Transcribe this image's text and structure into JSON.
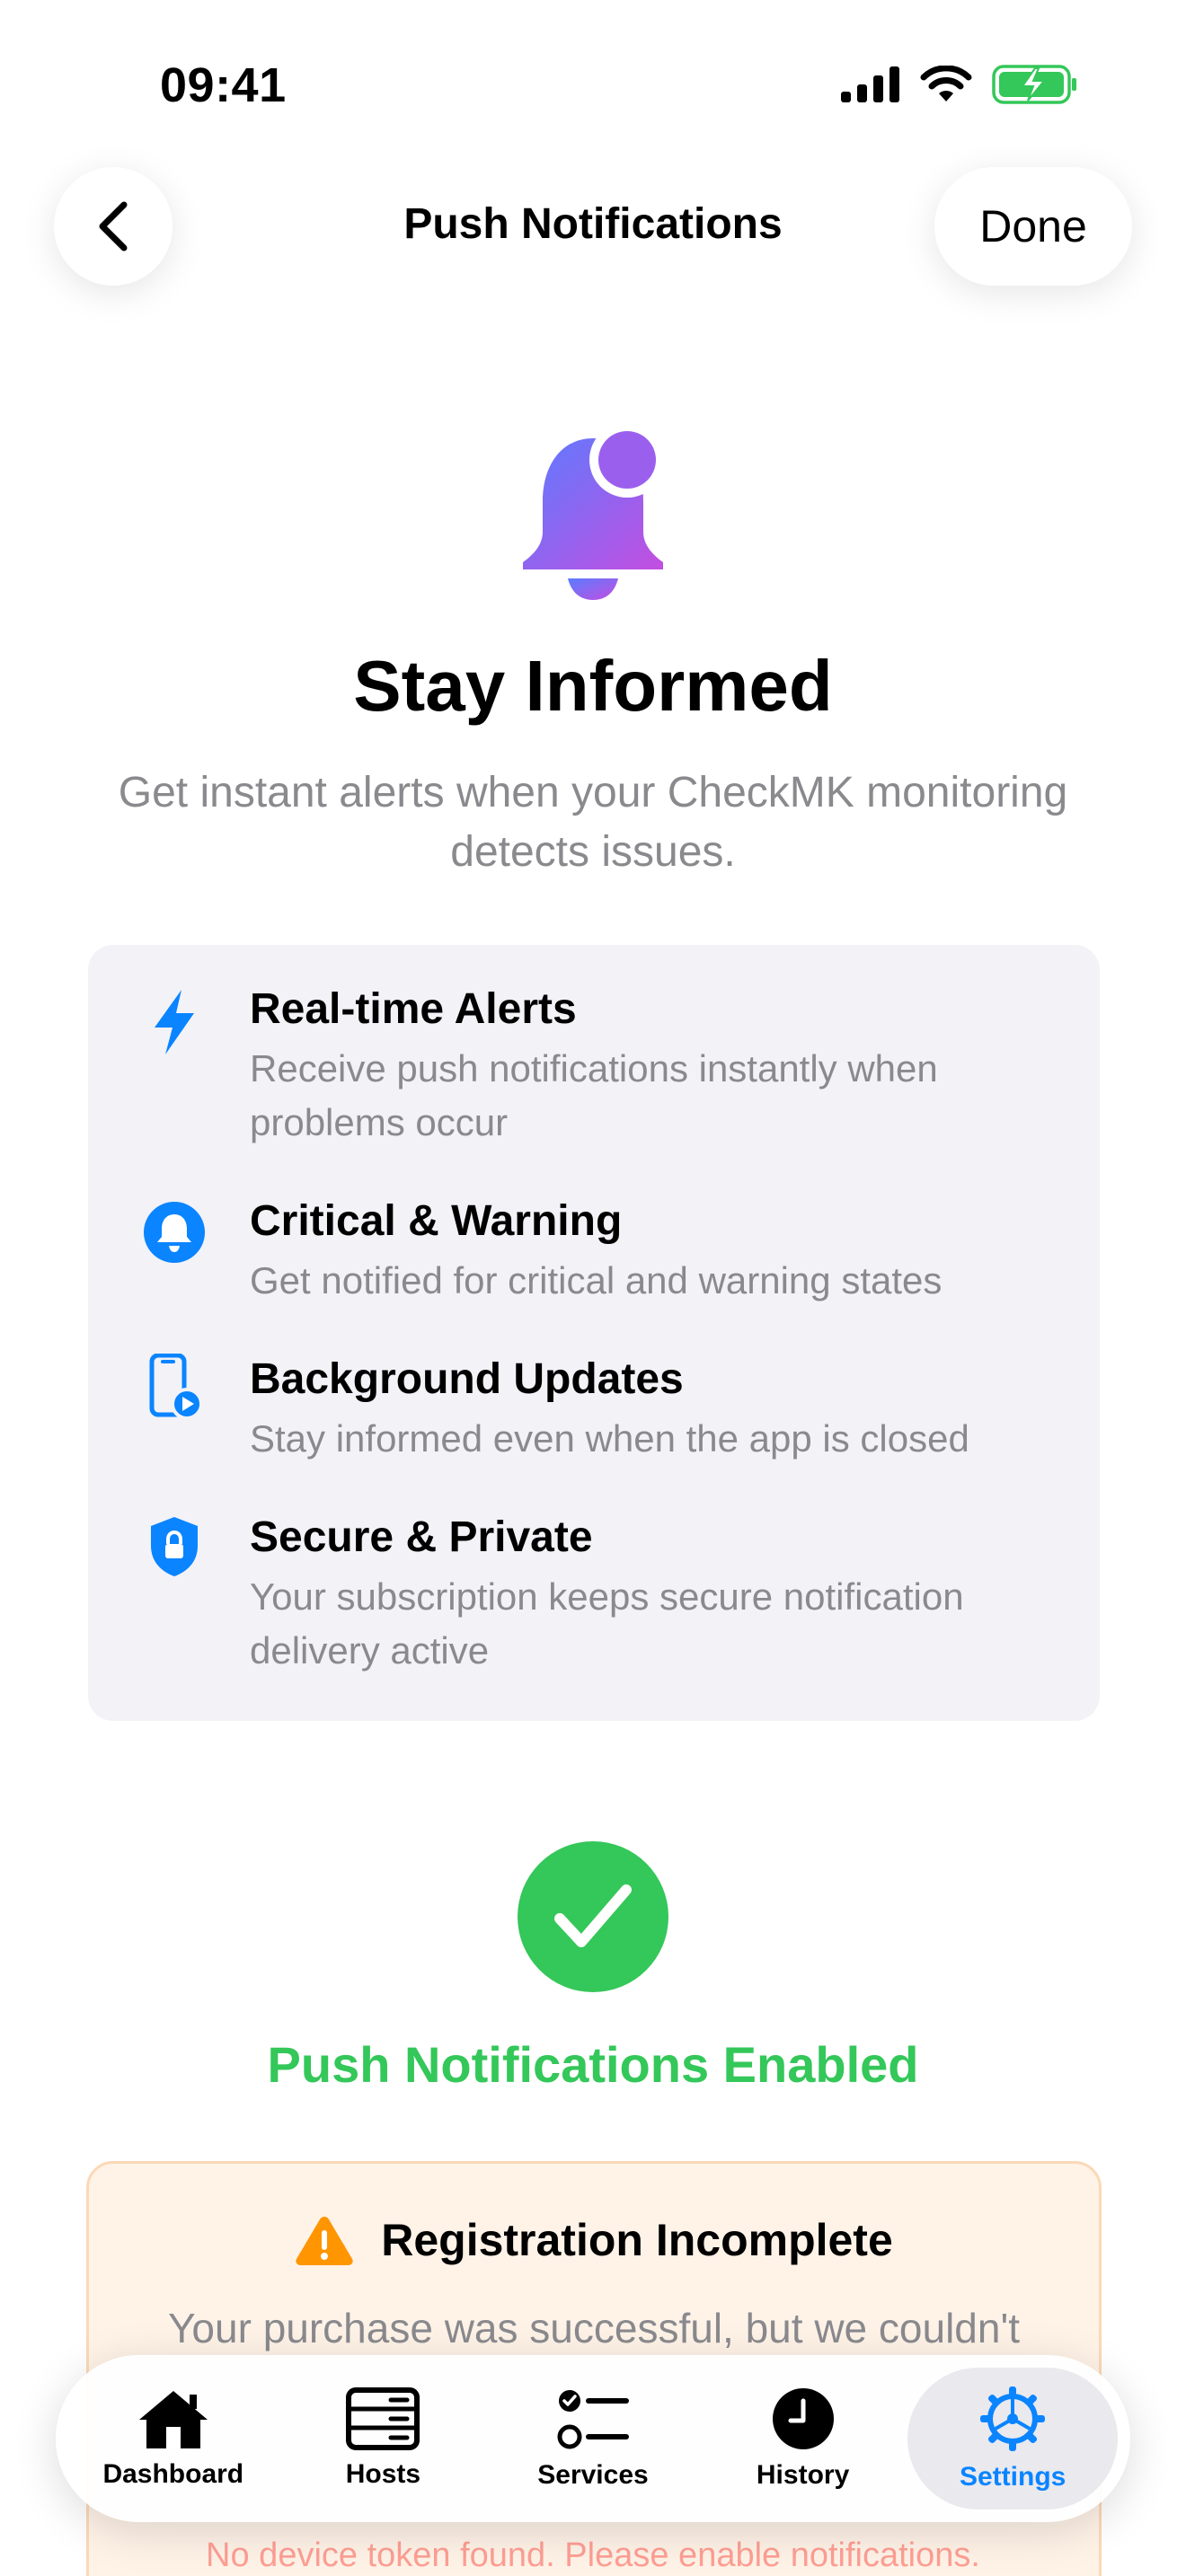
{
  "status_bar": {
    "time": "09:41"
  },
  "nav": {
    "title": "Push Notifications",
    "done_label": "Done"
  },
  "hero": {
    "title": "Stay Informed",
    "subtitle": "Get instant alerts when your CheckMK monitoring detects issues."
  },
  "features": [
    {
      "icon": "bolt-icon",
      "title": "Real-time Alerts",
      "description": "Receive push notifications instantly when problems occur"
    },
    {
      "icon": "bell-circle-icon",
      "title": "Critical & Warning",
      "description": "Get notified for critical and warning states"
    },
    {
      "icon": "phone-play-icon",
      "title": "Background Updates",
      "description": "Stay informed even when the app is closed"
    },
    {
      "icon": "shield-lock-icon",
      "title": "Secure & Private",
      "description": "Your subscription keeps secure notification delivery active"
    }
  ],
  "success": {
    "text": "Push Notifications Enabled"
  },
  "warning": {
    "title": "Registration Incomplete",
    "body": "Your purchase was successful, but we couldn't"
  },
  "bottom_error": "No device token found. Please enable notifications.",
  "tabs": [
    {
      "label": "Dashboard",
      "icon": "house-icon",
      "active": false
    },
    {
      "label": "Hosts",
      "icon": "server-icon",
      "active": false
    },
    {
      "label": "Services",
      "icon": "checklist-icon",
      "active": false
    },
    {
      "label": "History",
      "icon": "clock-icon",
      "active": false
    },
    {
      "label": "Settings",
      "icon": "gear-icon",
      "active": true
    }
  ],
  "colors": {
    "accent": "#0a84ff",
    "success": "#34c759",
    "warning": "#ff9500",
    "muted_text": "#8a8a8e",
    "card_bg": "#f2f2f7"
  }
}
